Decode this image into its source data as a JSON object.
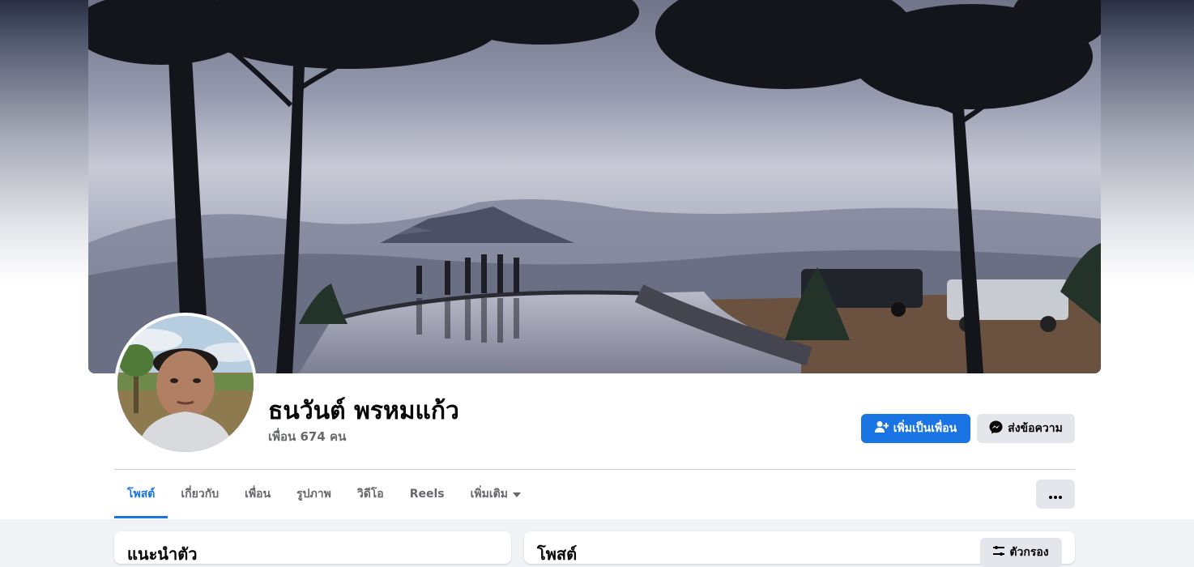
{
  "profile": {
    "name": "ธนวันต์ พรหมแก้ว",
    "friends_text": "เพื่อน 674 คน"
  },
  "actions": {
    "add_friend_label": "เพิ่มเป็นเพื่อน",
    "message_label": "ส่งข้อความ"
  },
  "tabs": [
    {
      "label": "โพสต์",
      "active": true
    },
    {
      "label": "เกี่ยวกับ",
      "active": false
    },
    {
      "label": "เพื่อน",
      "active": false
    },
    {
      "label": "รูปภาพ",
      "active": false
    },
    {
      "label": "วิดีโอ",
      "active": false
    },
    {
      "label": "Reels",
      "active": false
    },
    {
      "label": "เพิ่มเติม",
      "active": false
    }
  ],
  "cards": {
    "intro_title": "แนะนำตัว",
    "posts_title": "โพสต์",
    "filter_label": "ตัวกรอง"
  },
  "colors": {
    "accent": "#1b74e4",
    "secondary_button": "#e4e6eb",
    "page_background": "#f0f2f5"
  },
  "icons": {
    "add_friend": "person-plus-icon",
    "message": "messenger-icon",
    "more_tab": "caret-down-icon",
    "more_options": "ellipsis-icon",
    "filter": "filter-icon"
  }
}
